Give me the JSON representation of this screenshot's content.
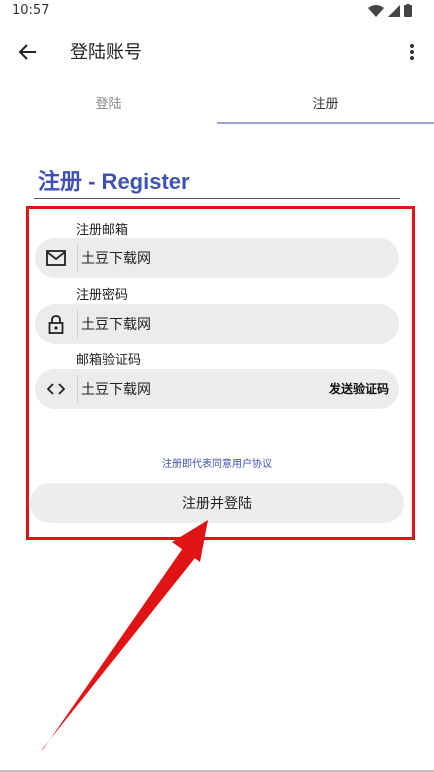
{
  "status": {
    "time": "10:57"
  },
  "appbar": {
    "title": "登陆账号"
  },
  "tabs": [
    {
      "label": "登陆"
    },
    {
      "label": "注册"
    }
  ],
  "form": {
    "title": "注册 - Register",
    "email": {
      "label": "注册邮箱",
      "value": "土豆下载网",
      "icon": "mail-icon"
    },
    "password": {
      "label": "注册密码",
      "value": "土豆下载网",
      "icon": "lock-icon"
    },
    "code": {
      "label": "邮箱验证码",
      "value": "土豆下载网",
      "icon": "code-icon",
      "send_label": "发送验证码"
    },
    "agreement": "注册即代表同意用户协议",
    "submit_label": "注册并登陆"
  },
  "colors": {
    "accent": "#3f51b5",
    "highlight": "#e01414"
  }
}
